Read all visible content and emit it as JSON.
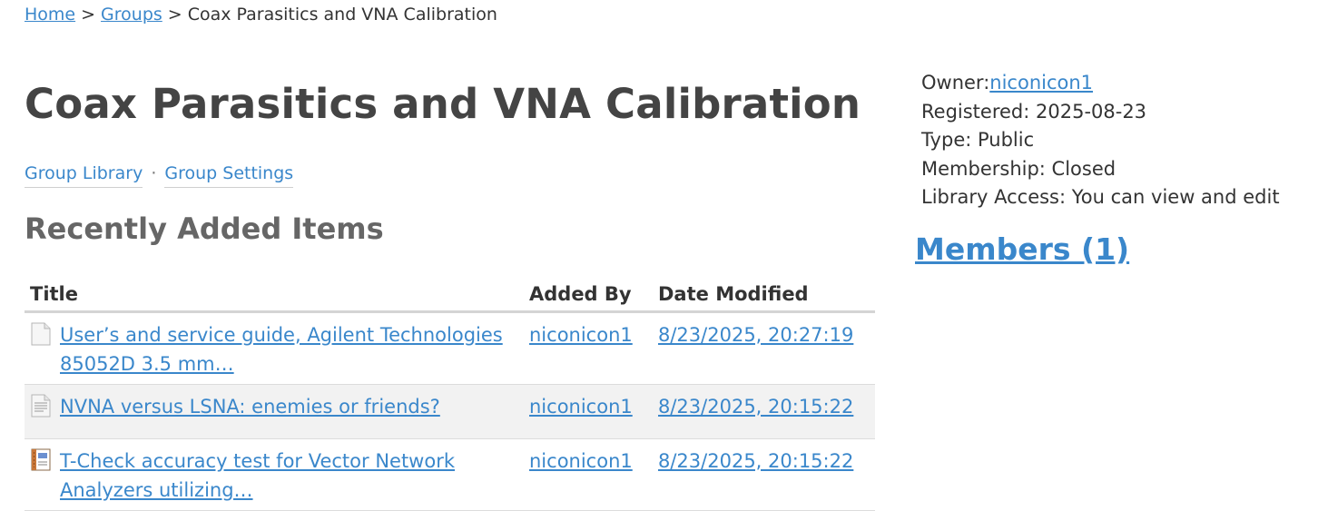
{
  "breadcrumb": {
    "home": "Home",
    "separator": ">",
    "groups": "Groups",
    "current": "Coax Parasitics and VNA Calibration"
  },
  "page_title": "Coax Parasitics and VNA Calibration",
  "group_nav": {
    "library": "Group Library",
    "dot": "·",
    "settings": "Group Settings"
  },
  "recent_heading": "Recently Added Items",
  "table": {
    "headers": {
      "title": "Title",
      "added_by": "Added By",
      "date_modified": "Date Modified"
    },
    "rows": [
      {
        "icon": "document-icon",
        "title": "User’s and service guide, Agilent Technologies 85052D 3.5 mm…",
        "added_by": "niconicon1",
        "date": "8/23/2025, 20:27:19"
      },
      {
        "icon": "text-document-icon",
        "title": "NVNA versus LSNA: enemies or friends?",
        "added_by": "niconicon1",
        "date": "8/23/2025, 20:15:22"
      },
      {
        "icon": "notebook-icon",
        "title": "T-Check accuracy test for Vector Network Analyzers utilizing…",
        "added_by": "niconicon1",
        "date": "8/23/2025, 20:15:22"
      }
    ]
  },
  "meta": {
    "owner_label": "Owner:",
    "owner_value": "niconicon1",
    "registered": "Registered: 2025-08-23",
    "type": "Type: Public",
    "membership": "Membership: Closed",
    "library_access": "Library Access: You can view and edit"
  },
  "members": "Members (1)",
  "colors": {
    "link": "#3a87cb",
    "heading": "#444444",
    "alt_row": "#f2f2f2"
  }
}
